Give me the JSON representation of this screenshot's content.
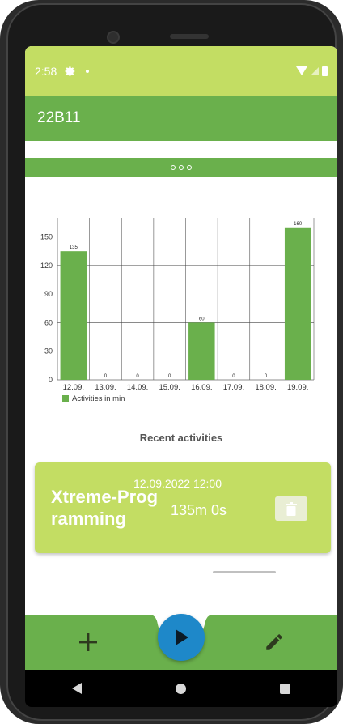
{
  "status_bar": {
    "time": "2:58",
    "icons": [
      "gear-icon",
      "notification-dot-icon",
      "wifi-icon",
      "cell-signal-icon",
      "battery-icon"
    ]
  },
  "app_bar": {
    "title": "22B11"
  },
  "collapse_bar": {
    "icon": "more-dots-icon"
  },
  "chart_data": {
    "type": "bar",
    "categories": [
      "12.09.",
      "13.09.",
      "14.09.",
      "15.09.",
      "16.09.",
      "17.09.",
      "18.09.",
      "19.09."
    ],
    "series": [
      {
        "name": "Activities in min",
        "values": [
          135,
          0,
          0,
          0,
          60,
          0,
          0,
          160
        ],
        "color": "#6ab04c"
      }
    ],
    "y_ticks": [
      "0",
      "30",
      "60",
      "90",
      "120",
      "150"
    ],
    "ylim": [
      0,
      170
    ],
    "grid": true,
    "legend": "bottom-left"
  },
  "recent": {
    "title": "Recent activities",
    "items": [
      {
        "date": "12.09.2022 12:00",
        "name": "Xtreme-Programming",
        "duration": "135m 0s",
        "delete_icon": "trash-icon"
      }
    ]
  },
  "bottom_bar": {
    "add_icon": "plus-icon",
    "play_icon": "play-icon",
    "edit_icon": "pencil-icon"
  },
  "colors": {
    "status_bar": "#c3dd63",
    "primary": "#6ab04c",
    "card": "#c3dd63",
    "fab": "#1e88c9"
  },
  "nav": {
    "icons": [
      "back-icon",
      "home-icon",
      "recents-icon"
    ]
  }
}
